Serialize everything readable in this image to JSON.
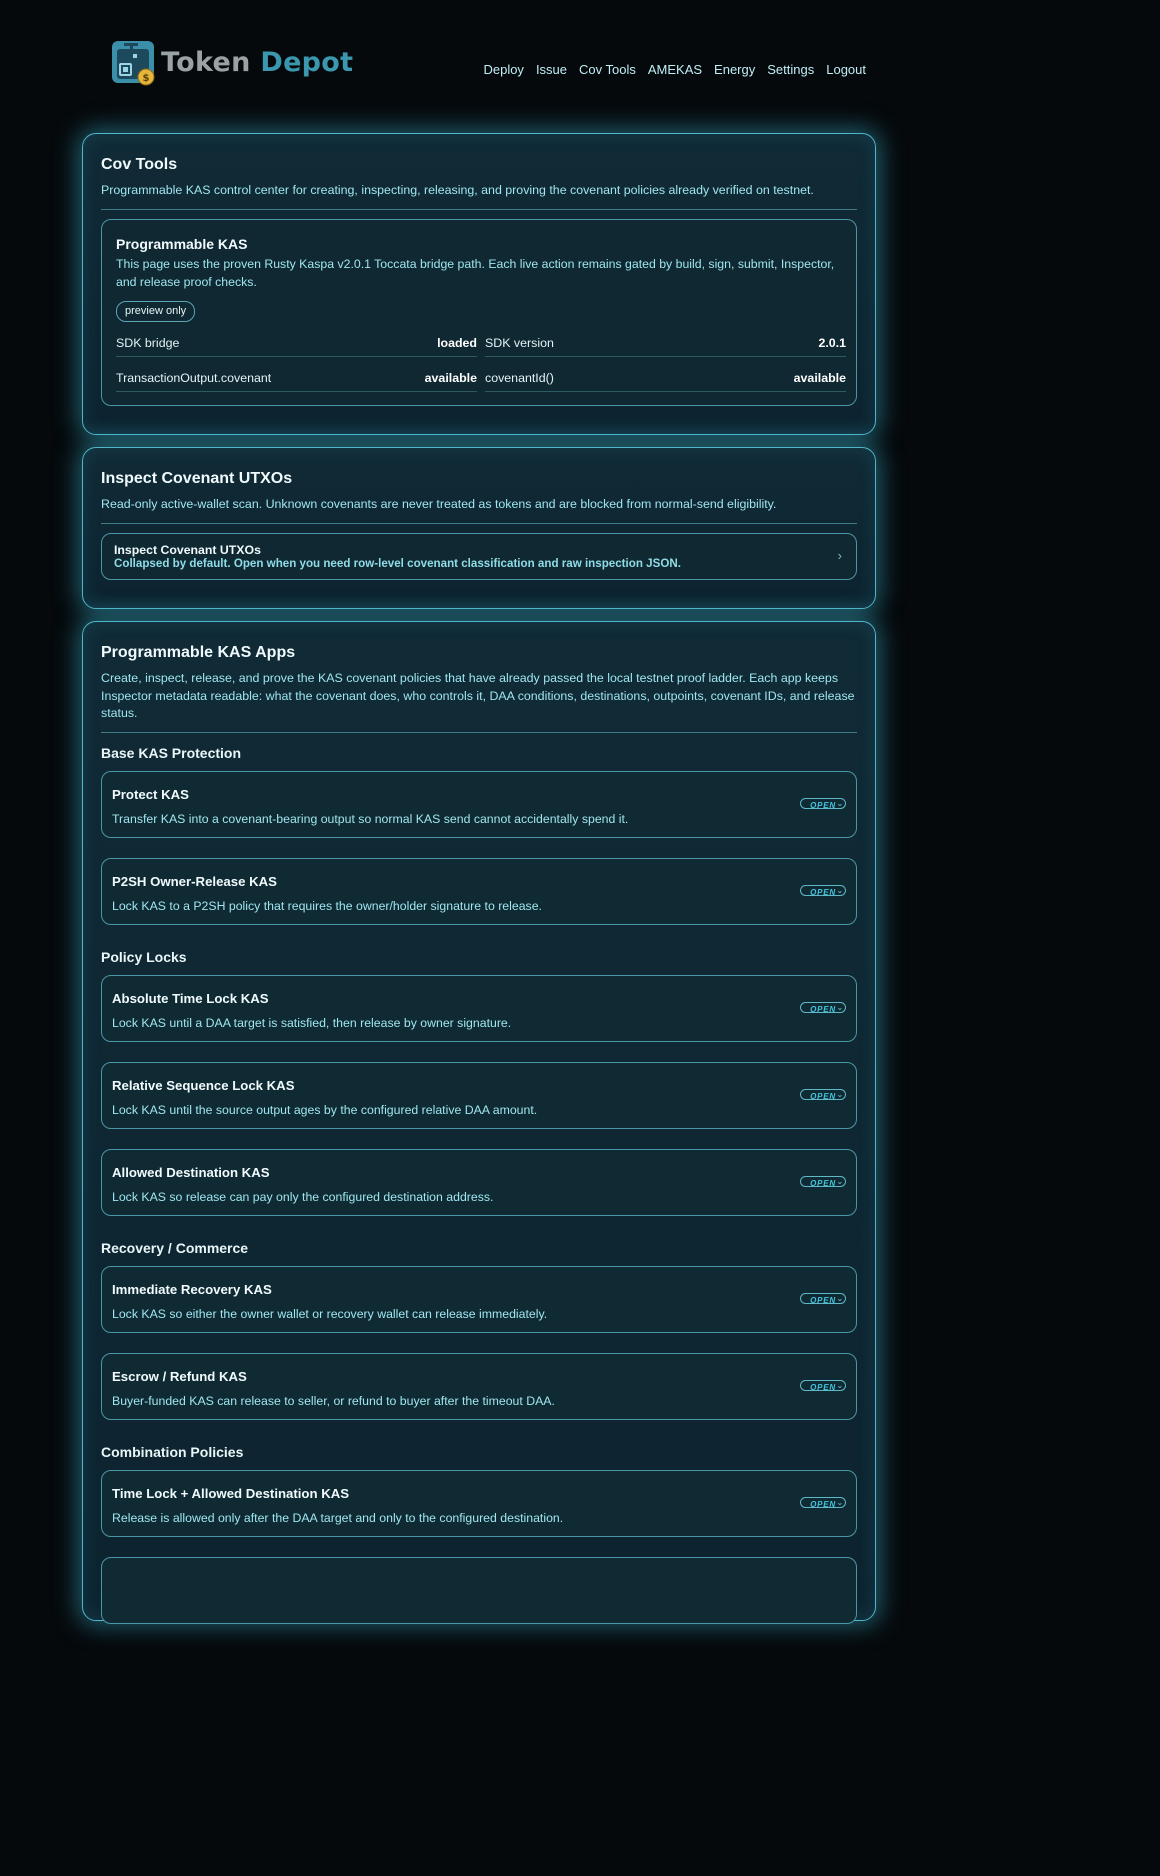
{
  "brand": {
    "part1": "To",
    "part_k": "k",
    "part2": "en",
    "part3": "Depot"
  },
  "nav": [
    "Deploy",
    "Issue",
    "Cov Tools",
    "AMEKAS",
    "Energy",
    "Settings",
    "Logout"
  ],
  "cov_tools": {
    "title": "Cov Tools",
    "desc": "Programmable KAS control center for creating, inspecting, releasing, and proving the covenant policies already verified on testnet.",
    "pk": {
      "title": "Programmable KAS",
      "desc": "This page uses the proven Rusty Kaspa v2.0.1 Toccata bridge path. Each live action remains gated by build, sign, submit, Inspector, and release proof checks.",
      "badge": "preview only",
      "kv": [
        {
          "k": "SDK bridge",
          "v": "loaded"
        },
        {
          "k": "SDK version",
          "v": "2.0.1"
        },
        {
          "k": "TransactionOutput.covenant",
          "v": "available"
        },
        {
          "k": "covenantId()",
          "v": "available"
        }
      ]
    }
  },
  "inspect": {
    "title": "Inspect Covenant UTXOs",
    "desc": "Read-only active-wallet scan. Unknown covenants are never treated as tokens and are blocked from normal-send eligibility.",
    "collapse_title": "Inspect Covenant UTXOs",
    "collapse_desc": "Collapsed by default. Open when you need row-level covenant classification and raw inspection JSON.",
    "chevron": "›"
  },
  "apps": {
    "title": "Programmable KAS Apps",
    "desc": "Create, inspect, release, and prove the KAS covenant policies that have already passed the local testnet proof ladder. Each app keeps Inspector metadata readable: what the covenant does, who controls it, DAA conditions, destinations, outpoints, covenant IDs, and release status.",
    "open_label": "OPEN",
    "sections": [
      {
        "title": "Base KAS Protection",
        "items": [
          {
            "title": "Protect KAS",
            "desc": "Transfer KAS into a covenant-bearing output so normal KAS send cannot accidentally spend it."
          },
          {
            "title": "P2SH Owner-Release KAS",
            "desc": "Lock KAS to a P2SH policy that requires the owner/holder signature to release."
          }
        ]
      },
      {
        "title": "Policy Locks",
        "items": [
          {
            "title": "Absolute Time Lock KAS",
            "desc": "Lock KAS until a DAA target is satisfied, then release by owner signature."
          },
          {
            "title": "Relative Sequence Lock KAS",
            "desc": "Lock KAS until the source output ages by the configured relative DAA amount."
          },
          {
            "title": "Allowed Destination KAS",
            "desc": "Lock KAS so release can pay only the configured destination address."
          }
        ]
      },
      {
        "title": "Recovery / Commerce",
        "items": [
          {
            "title": "Immediate Recovery KAS",
            "desc": "Lock KAS so either the owner wallet or recovery wallet can release immediately."
          },
          {
            "title": "Escrow / Refund KAS",
            "desc": "Buyer-funded KAS can release to seller, or refund to buyer after the timeout DAA."
          }
        ]
      },
      {
        "title": "Combination Policies",
        "items": [
          {
            "title": "Time Lock + Allowed Destination KAS",
            "desc": "Release is allowed only after the DAA target and only to the configured destination."
          }
        ]
      }
    ]
  }
}
